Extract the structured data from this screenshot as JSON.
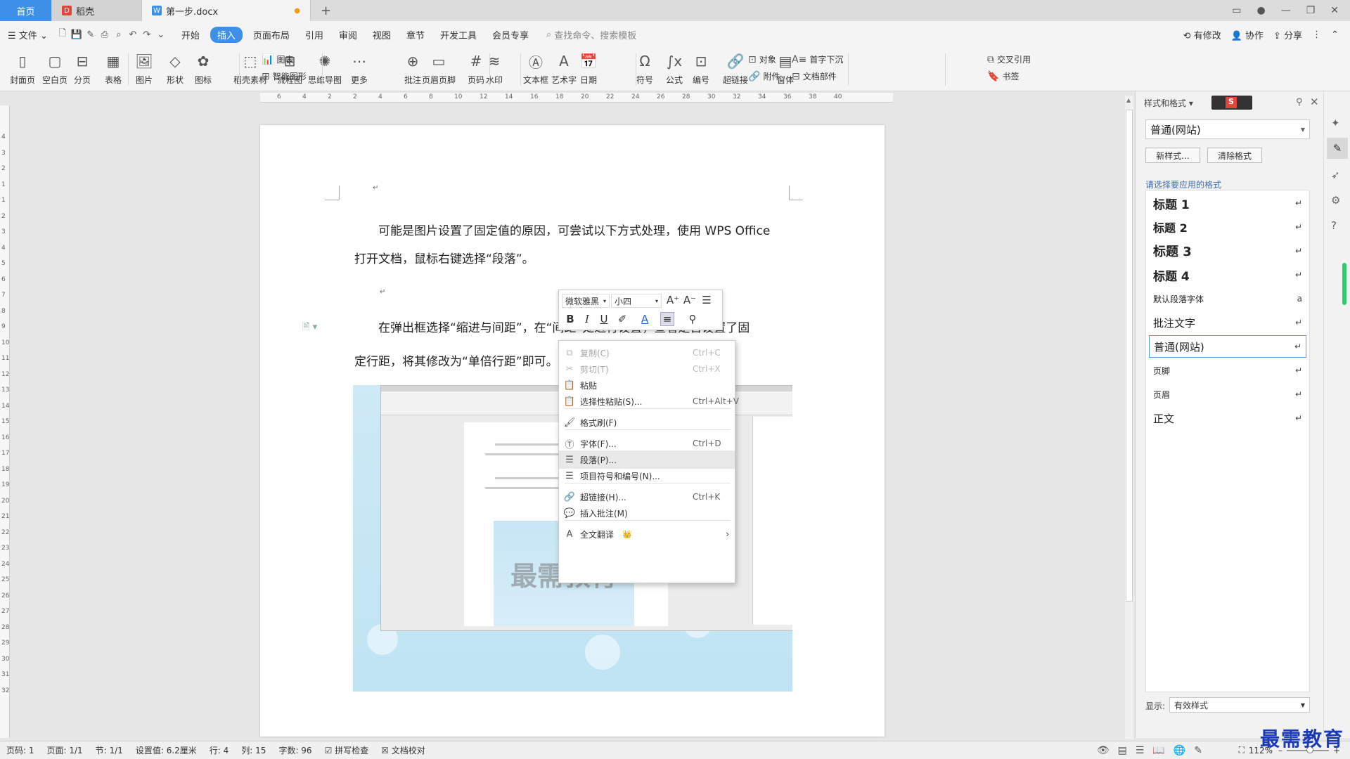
{
  "tabs": [
    {
      "label": "首页"
    },
    {
      "label": "稻壳"
    },
    {
      "label": "第一步.docx"
    }
  ],
  "menu": {
    "file": "文件",
    "items": [
      "开始",
      "插入",
      "页面布局",
      "引用",
      "审阅",
      "视图",
      "章节",
      "开发工具",
      "会员专享"
    ],
    "active": "插入",
    "search_placeholder": "查找命令、搜索模板",
    "right": [
      "有修改",
      "协作",
      "分享"
    ]
  },
  "ribbon": {
    "big": [
      "封面页",
      "空白页",
      "分页",
      "表格",
      "图片",
      "形状",
      "图标",
      "稻壳素材",
      "流程图",
      "思维导图",
      "更多",
      "批注",
      "页眉页脚",
      "页码",
      "水印",
      "文本框",
      "艺术字",
      "日期",
      "符号",
      "公式",
      "编号",
      "超链接",
      "窗体"
    ],
    "small": [
      "图表",
      "智能图形",
      "对象",
      "附件",
      "首字下沉",
      "文档部件",
      "交叉引用",
      "书签"
    ]
  },
  "ruler_ticks": [
    "6",
    "4",
    "2",
    "2",
    "4",
    "6",
    "8",
    "10",
    "12",
    "14",
    "16",
    "18",
    "20",
    "22",
    "24",
    "26",
    "28",
    "30",
    "32",
    "34",
    "36",
    "38",
    "40"
  ],
  "vruler_ticks": [
    "4",
    "3",
    "2",
    "1",
    "1",
    "2",
    "3",
    "4",
    "5",
    "6",
    "7",
    "8",
    "9",
    "10",
    "11",
    "12",
    "13",
    "14",
    "15",
    "16",
    "17",
    "18",
    "19",
    "20",
    "21",
    "22",
    "23",
    "24",
    "25",
    "26",
    "27",
    "28",
    "29",
    "30",
    "31",
    "32"
  ],
  "document": {
    "p1_line1": "可能是图片设置了固定值的原因，可尝试以下方式处理，使用 WPS Office",
    "p1_line2": "打开文档，鼠标右键选择“段落”。",
    "p2_line1": "在弹出框选择“缩进与间距”，在“间距”处进行设置，查看是否设置了固",
    "p2_line2": "定行距，将其修改为“单倍行距”即可。",
    "embed_watermark": "最需教育"
  },
  "mini_toolbar": {
    "font": "微软雅黑",
    "size": "小四"
  },
  "context_menu": [
    {
      "label": "复制(C)",
      "key": "Ctrl+C",
      "disabled": true
    },
    {
      "label": "剪切(T)",
      "key": "Ctrl+X",
      "disabled": true
    },
    {
      "label": "粘贴",
      "key": ""
    },
    {
      "label": "选择性粘贴(S)...",
      "key": "Ctrl+Alt+V"
    },
    {
      "label": "格式刷(F)",
      "key": ""
    },
    {
      "label": "字体(F)...",
      "key": "Ctrl+D"
    },
    {
      "label": "段落(P)...",
      "key": "",
      "highlight": true
    },
    {
      "label": "项目符号和编号(N)...",
      "key": ""
    },
    {
      "label": "超链接(H)...",
      "key": "Ctrl+K"
    },
    {
      "label": "插入批注(M)",
      "key": ""
    },
    {
      "label": "全文翻译",
      "key": ""
    }
  ],
  "styles_panel": {
    "title": "样式和格式",
    "current": "普通(网站)",
    "new_style": "新样式...",
    "clear_format": "清除格式",
    "prompt": "请选择要应用的格式",
    "styles": [
      {
        "label": "标题  1",
        "mark": "↵",
        "bold": true,
        "size": 17
      },
      {
        "label": "标题  2",
        "mark": "↵",
        "bold": true,
        "size": 16
      },
      {
        "label": "标题  3",
        "mark": "↵",
        "bold": true,
        "size": 18
      },
      {
        "label": "标题  4",
        "mark": "↵",
        "bold": true,
        "size": 17
      },
      {
        "label": "默认段落字体",
        "mark": "a",
        "bold": false,
        "size": 12
      },
      {
        "label": "批注文字",
        "mark": "↵",
        "bold": false,
        "size": 15
      },
      {
        "label": "普通(网站)",
        "mark": "↵",
        "bold": false,
        "size": 15,
        "selected": true
      },
      {
        "label": "页脚",
        "mark": "↵",
        "bold": false,
        "size": 12
      },
      {
        "label": "页眉",
        "mark": "↵",
        "bold": false,
        "size": 12
      },
      {
        "label": "正文",
        "mark": "↵",
        "bold": false,
        "size": 15
      }
    ],
    "show_label": "显示:",
    "show_value": "有效样式"
  },
  "status_bar": [
    "页码: 1",
    "页面: 1/1",
    "节: 1/1",
    "设置值: 6.2厘米",
    "行: 4",
    "列: 15",
    "字数: 96",
    "拼写检查",
    "文档校对"
  ],
  "zoom": "112%",
  "watermark": "最需教育",
  "colors": {
    "accent": "#3d8fe8",
    "brand_red": "#e0463a"
  }
}
